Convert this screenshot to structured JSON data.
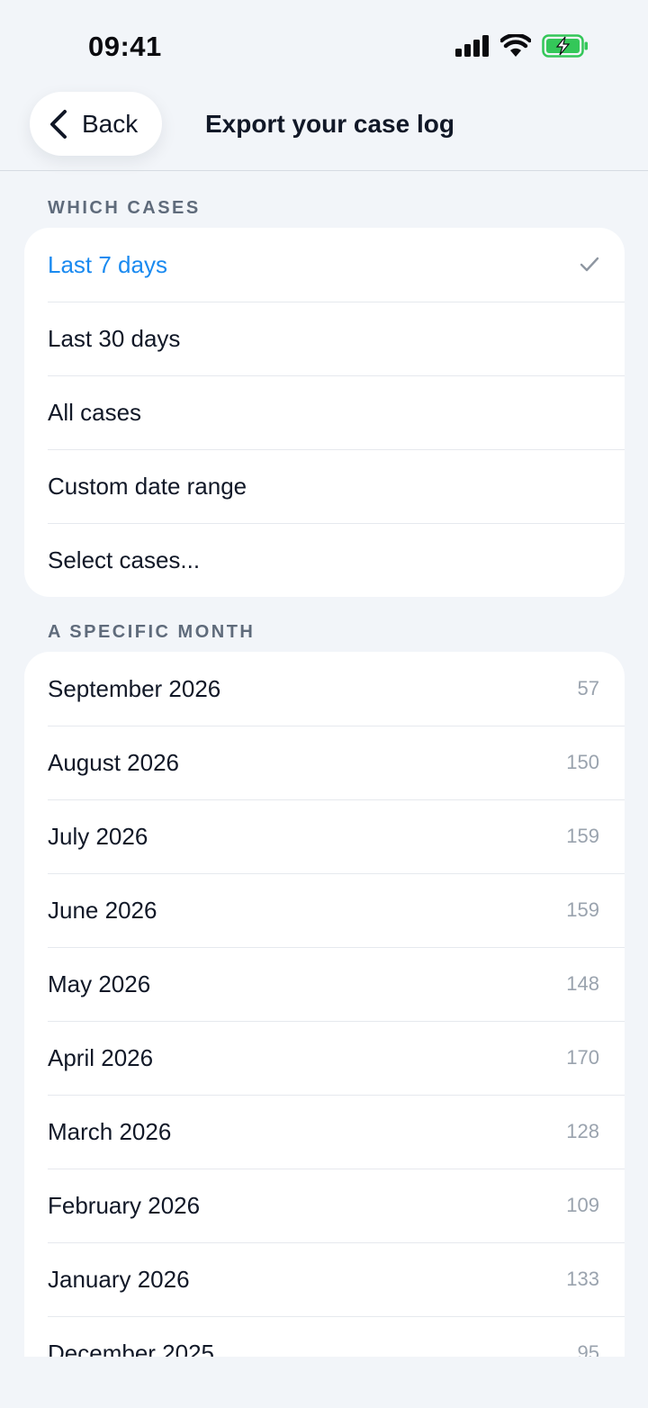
{
  "status_bar": {
    "time": "09:41",
    "icons": [
      "signal-icon",
      "wifi-icon",
      "battery-charging-icon"
    ],
    "battery_color": "#34c759"
  },
  "nav": {
    "back_label": "Back",
    "title": "Export your case log"
  },
  "which_cases": {
    "header": "WHICH CASES",
    "options": [
      {
        "label": "Last 7 days",
        "selected": true
      },
      {
        "label": "Last 30 days",
        "selected": false
      },
      {
        "label": "All cases",
        "selected": false
      },
      {
        "label": "Custom date range",
        "selected": false
      },
      {
        "label": "Select cases...",
        "selected": false
      }
    ],
    "accent_color": "#1a8af0"
  },
  "specific_month": {
    "header": "A SPECIFIC MONTH",
    "months": [
      {
        "label": "September 2026",
        "count": "57"
      },
      {
        "label": "August 2026",
        "count": "150"
      },
      {
        "label": "July 2026",
        "count": "159"
      },
      {
        "label": "June 2026",
        "count": "159"
      },
      {
        "label": "May 2026",
        "count": "148"
      },
      {
        "label": "April 2026",
        "count": "170"
      },
      {
        "label": "March 2026",
        "count": "128"
      },
      {
        "label": "February 2026",
        "count": "109"
      },
      {
        "label": "January 2026",
        "count": "133"
      },
      {
        "label": "December 2025",
        "count": "95"
      }
    ]
  }
}
